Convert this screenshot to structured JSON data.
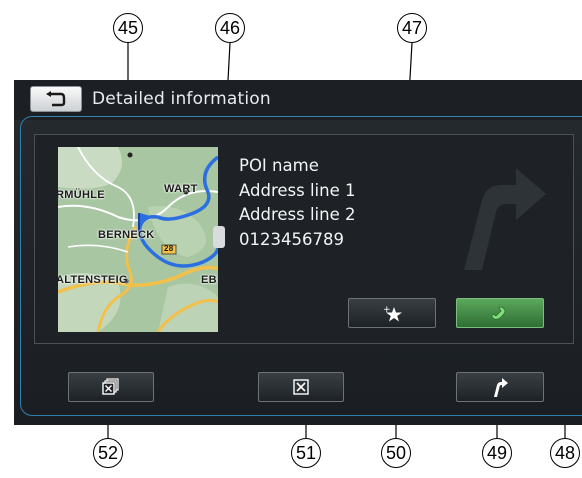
{
  "header": {
    "title": "Detailed information"
  },
  "map": {
    "labels": [
      "RMÜHLE",
      "WART",
      "BERNECK",
      "ALTENSTEIG",
      "EB"
    ],
    "road_shield": "28"
  },
  "poi": {
    "name": "POI name",
    "address1": "Address line 1",
    "address2": "Address line 2",
    "phone": "0123456789"
  },
  "callouts": [
    "45",
    "46",
    "47",
    "48",
    "49",
    "50",
    "51",
    "52"
  ],
  "icons": {
    "back": "back-arrow-icon",
    "favorite": "add-favorite-star-icon",
    "call": "phone-handset-icon",
    "route": "route-arrow-icon",
    "delete": "delete-x-icon",
    "delete_all": "delete-all-icon"
  },
  "colors": {
    "accent": "#2f7fb0",
    "call": "#4b9a4f",
    "screen": "#1e2226"
  }
}
